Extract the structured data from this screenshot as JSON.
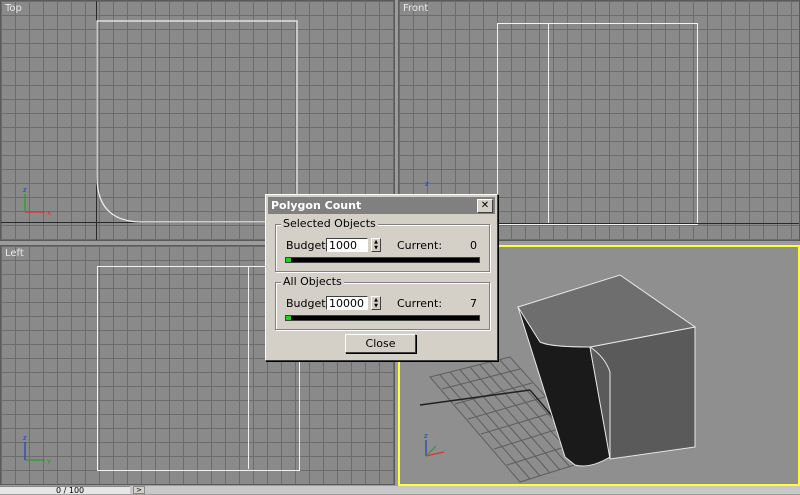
{
  "viewports": {
    "top": {
      "label": "Top"
    },
    "front": {
      "label": "Front"
    },
    "left": {
      "label": "Left"
    }
  },
  "dialog": {
    "title": "Polygon Count",
    "close_x": "✕",
    "selected": {
      "group_label": "Selected Objects",
      "budget_label": "Budget:",
      "budget_value": "1000",
      "current_label": "Current:",
      "current_value": "0"
    },
    "all": {
      "group_label": "All Objects",
      "budget_label": "Budget:",
      "budget_value": "10000",
      "current_label": "Current:",
      "current_value": "7"
    },
    "close_label": "Close",
    "bar_color": "#1ad41a"
  },
  "statusbar": {
    "frame_counter": "0 / 100",
    "scroll_right": ">"
  }
}
